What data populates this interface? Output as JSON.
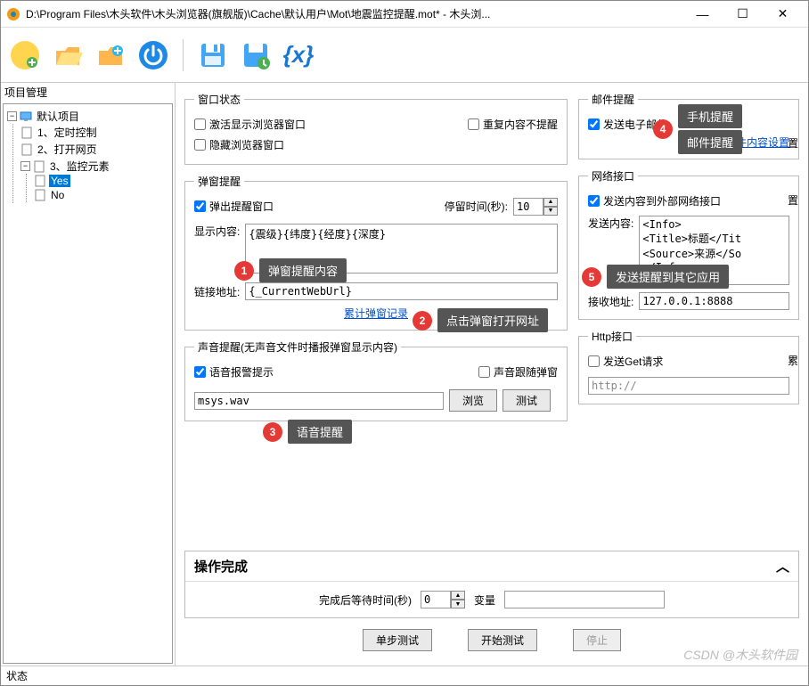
{
  "window": {
    "title": "D:\\Program Files\\木头软件\\木头浏览器(旗舰版)\\Cache\\默认用户\\Mot\\地震监控提醒.mot* - 木头浏...",
    "min": "—",
    "max": "☐",
    "close": "✕"
  },
  "toolbar": {
    "var_glyph": "{x}"
  },
  "sidebar": {
    "title": "项目管理",
    "root": "默认项目",
    "items": [
      "1、定时控制",
      "2、打开网页",
      "3、监控元素"
    ],
    "sub": [
      "Yes",
      "No"
    ]
  },
  "groups": {
    "win_state": {
      "legend": "窗口状态",
      "act_show": "激活显示浏览器窗口",
      "hide": "隐藏浏览器窗口",
      "no_repeat": "重复内容不提醒"
    },
    "popup": {
      "legend": "弹窗提醒",
      "show_popup": "弹出提醒窗口",
      "stay_label": "停留时间(秒):",
      "stay_value": "10",
      "content_label": "显示内容:",
      "content_value": "{震级}{纬度}{经度}{深度}",
      "link_label": "链接地址:",
      "link_value": "{_CurrentWebUrl}",
      "history": "累计弹窗记录"
    },
    "sound": {
      "legend": "声音提醒(无声音文件时播报弹窗显示内容)",
      "voice_alarm": "语音报警提示",
      "follow_popup": "声音跟随弹窗",
      "file": "msys.wav",
      "browse": "浏览",
      "test": "测试"
    },
    "mail": {
      "legend": "邮件提醒",
      "send": "发送电子邮件",
      "cfg": "邮件内容设置",
      "cut": "置"
    },
    "net": {
      "legend": "网络接口",
      "send_ext": "发送内容到外部网络接口",
      "cut": "置",
      "send_label": "发送内容:",
      "send_value": "<Info>\n<Title>标题</Tit\n<Source>来源</So\n</Info>",
      "recv_label": "接收地址:",
      "recv_value": "127.0.0.1:8888"
    },
    "http": {
      "legend": "Http接口",
      "get": "发送Get请求",
      "cut": "累",
      "url": "http://"
    },
    "done": {
      "title": "操作完成",
      "wait_label": "完成后等待时间(秒)",
      "wait_value": "0",
      "var_label": "变量"
    }
  },
  "buttons": {
    "step": "单步测试",
    "start": "开始测试",
    "stop": "停止"
  },
  "status": "状态",
  "watermark": "CSDN @木头软件园",
  "callouts": {
    "c1": "弹窗提醒内容",
    "c2": "点击弹窗打开网址",
    "c3": "语音提醒",
    "c4a": "手机提醒",
    "c4b": "邮件提醒",
    "c5": "发送提醒到其它应用"
  }
}
